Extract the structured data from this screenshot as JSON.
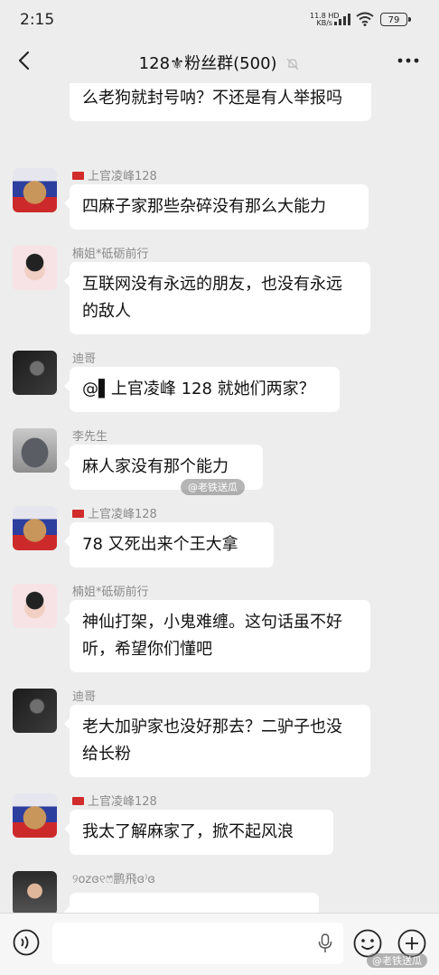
{
  "status": {
    "time": "2:15",
    "net_speed_top": "11.8",
    "net_speed_bottom": "KB/s",
    "net_type": "HD",
    "battery": "79"
  },
  "header": {
    "title": "128⚜粉丝群(500)"
  },
  "messages": [
    {
      "sender": "",
      "text": "么老狗就封号呐？不还是有人举报吗"
    },
    {
      "sender": "上官凌峰128",
      "text": "四麻子家那些杂碎没有那么大能力"
    },
    {
      "sender": "楠姐*砥砺前行",
      "text": "互联网没有永远的朋友，也没有永远的敌人"
    },
    {
      "sender": "迪哥",
      "text": "@▌上官凌峰 128 就她们两家？"
    },
    {
      "sender": "李先生",
      "text": "麻人家没有那个能力"
    },
    {
      "sender": "上官凌峰128",
      "text": "78  又死出来个王大拿"
    },
    {
      "sender": "楠姐*砥砺前行",
      "text": "神仙打架，小鬼难缠。这句话虽不好听，希望你们懂吧"
    },
    {
      "sender": "迪哥",
      "text": "老大加驴家也没好那去？二驴子也没给长粉"
    },
    {
      "sender": "上官凌峰128",
      "text": "我太了解麻家了，掀不起风浪"
    },
    {
      "sender": "୨ᴏᴢɞ୧ෆ᷈鹏飛ɞ⁾ɞ",
      "text": ""
    }
  ],
  "watermarks": {
    "middle": "@老铁送瓜",
    "bottom": "@老铁送瓜"
  },
  "icons": {
    "back": "back-arrow-icon",
    "mute": "mute-bell-icon",
    "more": "more-dots-icon",
    "voice": "voice-icon",
    "mic": "microphone-icon",
    "emoji": "emoji-icon",
    "plus": "plus-icon"
  }
}
